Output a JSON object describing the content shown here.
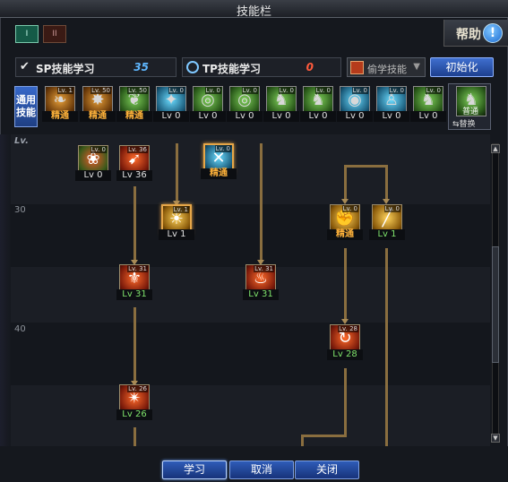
{
  "window": {
    "title": "技能栏"
  },
  "tabs": [
    {
      "label": "I",
      "active": true
    },
    {
      "label": "II",
      "active": false
    }
  ],
  "help": {
    "label": "帮助",
    "icon": "help-icon"
  },
  "sp": {
    "label": "SP技能学习",
    "value": "35"
  },
  "tp": {
    "label": "TP技能学习",
    "value": "0"
  },
  "steal": {
    "label": "偷学技能"
  },
  "reset": {
    "label": "初始化"
  },
  "general": {
    "label": "通用技能",
    "items": [
      {
        "lv": "Lv. 1",
        "caption": "精通",
        "style": "master",
        "color": "orange",
        "glyph": "❧"
      },
      {
        "lv": "Lv. 50",
        "caption": "精通",
        "style": "master",
        "color": "orange",
        "glyph": "✸"
      },
      {
        "lv": "Lv. 50",
        "caption": "精通",
        "style": "master",
        "color": "green",
        "glyph": "❦"
      },
      {
        "lv": "Lv. 0",
        "caption": "Lv 0",
        "style": "normal",
        "color": "cyan",
        "glyph": "✦"
      },
      {
        "lv": "Lv. 0",
        "caption": "Lv 0",
        "style": "normal",
        "color": "green",
        "glyph": "◎"
      },
      {
        "lv": "Lv. 0",
        "caption": "Lv 0",
        "style": "normal",
        "color": "green",
        "glyph": "◎"
      },
      {
        "lv": "Lv. 0",
        "caption": "Lv 0",
        "style": "normal",
        "color": "green",
        "glyph": "♞"
      },
      {
        "lv": "Lv. 0",
        "caption": "Lv 0",
        "style": "normal",
        "color": "green",
        "glyph": "♞"
      },
      {
        "lv": "Lv. 0",
        "caption": "Lv 0",
        "style": "normal",
        "color": "cyan",
        "glyph": "◉"
      },
      {
        "lv": "Lv. 0",
        "caption": "Lv 0",
        "style": "normal",
        "color": "cyan",
        "glyph": "♙"
      },
      {
        "lv": "Lv. 0",
        "caption": "Lv 0",
        "style": "normal",
        "color": "green",
        "glyph": "♞"
      }
    ],
    "swap": {
      "icon_caption": "普通",
      "label": "⇆替换"
    }
  },
  "tree": {
    "lv_header": "Lv.",
    "rows": [
      "30",
      "40"
    ],
    "skills": [
      {
        "id": "s1",
        "lv": "Lv. 0",
        "caption": "Lv 0",
        "style": "normal",
        "color": "multi",
        "glyph": "❀"
      },
      {
        "id": "s2",
        "lv": "Lv. 36",
        "caption": "Lv 36",
        "style": "normal",
        "color": "red",
        "glyph": "➹"
      },
      {
        "id": "s3",
        "lv": "Lv. 0",
        "caption": "精通",
        "style": "master",
        "color": "cyan",
        "glyph": "✕"
      },
      {
        "id": "s4",
        "lv": "Lv. 1",
        "caption": "Lv 1",
        "style": "normal",
        "color": "gold",
        "glyph": "☀"
      },
      {
        "id": "s5",
        "lv": "Lv. 0",
        "caption": "精通",
        "style": "master",
        "color": "gold",
        "glyph": "✊"
      },
      {
        "id": "s6",
        "lv": "Lv. 0",
        "caption": "Lv 1",
        "style": "green",
        "color": "gold",
        "glyph": "╱"
      },
      {
        "id": "s7",
        "lv": "Lv. 31",
        "caption": "Lv 31",
        "style": "green",
        "color": "red",
        "glyph": "⚜"
      },
      {
        "id": "s8",
        "lv": "Lv. 31",
        "caption": "Lv 31",
        "style": "green",
        "color": "red",
        "glyph": "♨"
      },
      {
        "id": "s9",
        "lv": "Lv. 28",
        "caption": "Lv 28",
        "style": "green",
        "color": "red",
        "glyph": "↻"
      },
      {
        "id": "s10",
        "lv": "Lv. 26",
        "caption": "Lv 26",
        "style": "green",
        "color": "red",
        "glyph": "✴"
      }
    ]
  },
  "buttons": {
    "learn": "学习",
    "cancel": "取消",
    "close": "关闭"
  }
}
